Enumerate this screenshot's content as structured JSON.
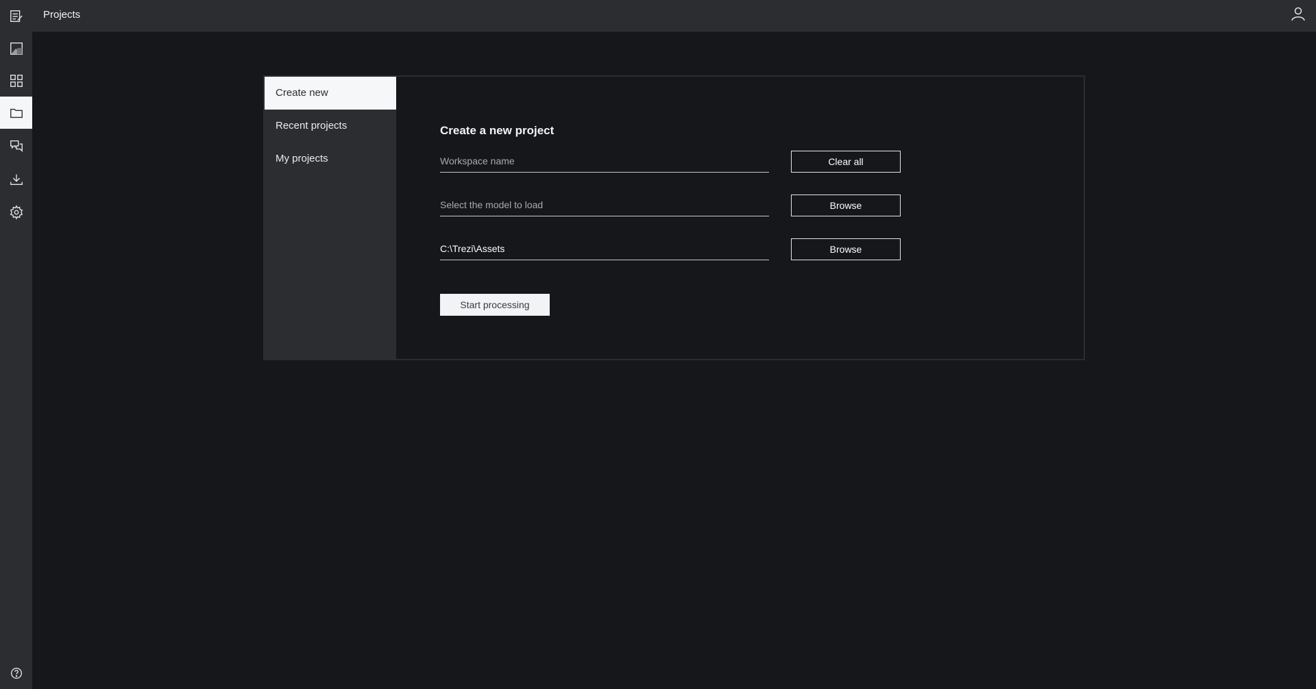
{
  "header": {
    "title": "Projects"
  },
  "sidebar": {
    "items": [
      {
        "name": "notes-icon"
      },
      {
        "name": "image-icon"
      },
      {
        "name": "grid-icon"
      },
      {
        "name": "folder-icon",
        "active": true
      },
      {
        "name": "chat-icon"
      },
      {
        "name": "download-icon"
      },
      {
        "name": "gear-icon"
      }
    ],
    "bottom": {
      "name": "help-icon"
    }
  },
  "nav": {
    "items": [
      {
        "label": "Create new"
      },
      {
        "label": "Recent projects"
      },
      {
        "label": "My projects"
      }
    ]
  },
  "form": {
    "title": "Create a new project",
    "workspace_placeholder": "Workspace name",
    "workspace_value": "",
    "model_placeholder": "Select the model to load",
    "model_value": "",
    "path_value": "C:\\Trezi\\Assets",
    "clear_label": "Clear all",
    "browse_label": "Browse",
    "start_label": "Start processing"
  },
  "colors": {
    "background": "#16171b",
    "chrome": "#2c2d31",
    "active": "#f5f6f8"
  }
}
